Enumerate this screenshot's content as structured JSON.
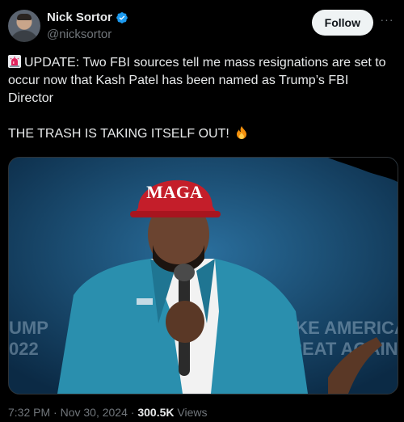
{
  "author": {
    "display_name": "Nick Sortor",
    "handle": "@nicksortor",
    "verified": true
  },
  "follow_label": "Follow",
  "more_label": "···",
  "tweet": {
    "line1": "UPDATE: Two FBI sources tell me mass resignations are set to occur now that Kash Patel has been named as Trump’s FBI Director",
    "line2": "THE TRASH IS TAKING ITSELF OUT!",
    "emoji_leading": "siren-icon",
    "emoji_trailing": "fire-icon"
  },
  "media": {
    "hat_text": "MAGA",
    "banner_left": "UMP\n022",
    "banner_right": "MAKE AMERICA\nGREAT AGAIN"
  },
  "meta": {
    "time": "7:32 PM",
    "date": "Nov 30, 2024",
    "separator": "·",
    "views_count": "300.5K",
    "views_label": "Views"
  },
  "colors": {
    "background": "#000000",
    "text": "#e7e9ea",
    "secondary": "#71767b",
    "verified": "#1d9bf0",
    "follow_bg": "#eff3f4"
  }
}
